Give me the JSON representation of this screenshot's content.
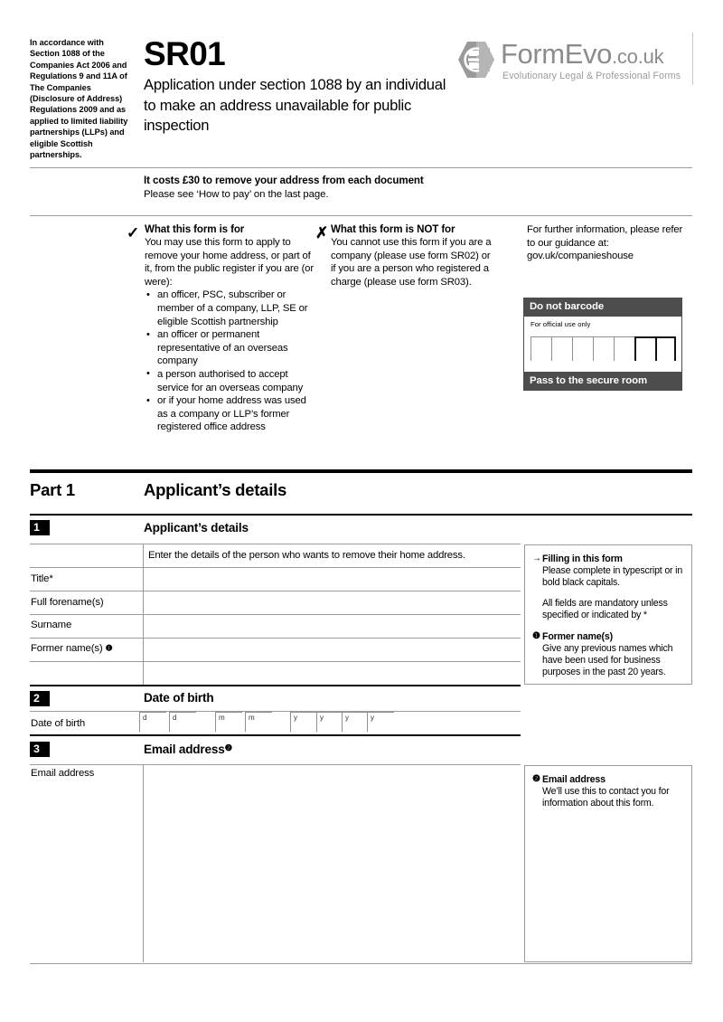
{
  "header": {
    "accordance_note": "In accordance with Section 1088 of the Companies Act 2006 and Regulations 9 and 11A of The Companies (Disclosure of Address) Regulations 2009 and as applied to limited liability partnerships (LLPs) and eligible Scottish partnerships.",
    "form_code": "SR01",
    "form_title": "Application under section 1088 by an individual to make an address unavailable for public inspection"
  },
  "logo": {
    "name": "FormEvo",
    "tld": ".co.uk",
    "tagline": "Evolutionary Legal & Professional Forms",
    "color": "#8c8c8c"
  },
  "cost": {
    "headline": "It costs £30 to remove your address from each document",
    "subline": "Please see ‘How to pay’ on the last page."
  },
  "info": {
    "for": {
      "mark": "✓",
      "heading": "What this form is for",
      "body": "You may use this form to apply to remove your home address, or part of it, from the public register if you are (or were):",
      "bullets": [
        "an officer, PSC, subscriber or member of a company, LLP, SE or eligible Scottish partnership",
        "an officer or permanent representative of an overseas company",
        "a person authorised to accept service for an overseas company",
        "or if your home address was used as a company or LLP’s former registered office address"
      ]
    },
    "not_for": {
      "mark": "✗",
      "heading": "What this form is NOT for",
      "body": "You cannot use this form if you are a company (please use form SR02) or if you are a person who registered a charge (please use form SR03)."
    },
    "further": "For further information, please refer to our guidance at: gov.uk/companieshouse"
  },
  "barcode": {
    "top_label": "Do not barcode",
    "official_label": "For official use only",
    "bottom_label": "Pass to the secure room",
    "cell_count": 7,
    "dark_cells": 2,
    "bar_color": "#4d4d4d"
  },
  "part": {
    "label": "Part 1",
    "title": "Applicant’s details"
  },
  "sections": [
    {
      "number": "1",
      "title": "Applicant’s details",
      "hint": "Enter the details of the person who wants to remove their home address.",
      "fields": [
        {
          "label": "Title*",
          "value": ""
        },
        {
          "label": "Full forename(s)",
          "value": ""
        },
        {
          "label": "Surname",
          "value": ""
        },
        {
          "label": "Former name(s)",
          "marker": "❶",
          "value": ""
        },
        {
          "label": "",
          "value": ""
        }
      ]
    },
    {
      "number": "2",
      "title": "Date of birth",
      "field_label": "Date of birth",
      "date_boxes": [
        "d",
        "d",
        "m",
        "m",
        "y",
        "y",
        "y",
        "y"
      ]
    },
    {
      "number": "3",
      "title": "Email address",
      "title_marker": "❷",
      "field_label": "Email address",
      "value": ""
    }
  ],
  "guidance": {
    "panel_one": [
      {
        "mark": "→",
        "heading": "Filling in this form",
        "body": "Please complete in typescript or in bold black capitals.",
        "body2": "All fields are mandatory unless specified or indicated by *"
      },
      {
        "mark": "❶",
        "heading": "Former name(s)",
        "body": "Give any previous names which have been used for business purposes in the past 20 years."
      }
    ],
    "panel_two": [
      {
        "mark": "❷",
        "heading": "Email address",
        "body": "We’ll use this to contact you for information about this form."
      }
    ]
  }
}
